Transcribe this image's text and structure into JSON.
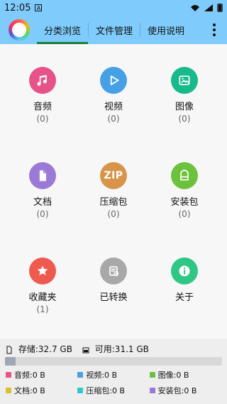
{
  "status": {
    "time": "12:05"
  },
  "header": {
    "tabs": [
      {
        "label": "分类浏览"
      },
      {
        "label": "文件管理"
      },
      {
        "label": "使用说明"
      }
    ]
  },
  "categories": [
    {
      "label": "音频",
      "count": "(0)",
      "color": "#e8528a"
    },
    {
      "label": "视频",
      "count": "(0)",
      "color": "#45a0e6"
    },
    {
      "label": "图像",
      "count": "(0)",
      "color": "#18b98b"
    },
    {
      "label": "文档",
      "count": "(0)",
      "color": "#9b79d6"
    },
    {
      "label": "压缩包",
      "count": "(0)",
      "color": "#d8944a",
      "icon_text": "ZIP"
    },
    {
      "label": "安装包",
      "count": "(0)",
      "color": "#6cc23d"
    },
    {
      "label": "收藏夹",
      "count": "(1)",
      "color": "#ef5a4f"
    },
    {
      "label": "已转换",
      "count": "",
      "color": "#a8a8a8"
    },
    {
      "label": "关于",
      "count": "",
      "color": "#2fc785"
    }
  ],
  "storage": {
    "summary": {
      "storage": "存储:32.7 GB",
      "available": "可用:31.1 GB"
    },
    "used_fraction": 0.049,
    "legend": [
      {
        "label": "音频:0 B",
        "color": "#e8528a"
      },
      {
        "label": "视频:0 B",
        "color": "#45a0e6"
      },
      {
        "label": "图像:0 B",
        "color": "#6cc23d"
      },
      {
        "label": "文档:0 B",
        "color": "#d6c22b"
      },
      {
        "label": "压缩包:0 B",
        "color": "#35c7c7"
      },
      {
        "label": "安装包:0 B",
        "color": "#9b79d6"
      }
    ]
  }
}
